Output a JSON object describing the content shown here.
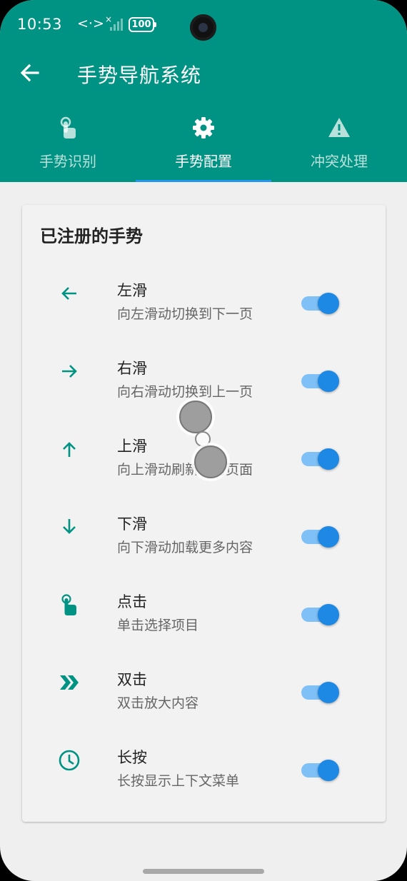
{
  "status_bar": {
    "time": "10:53",
    "network_symbol": "<·>",
    "network_flag": "×",
    "battery": "100"
  },
  "app_bar": {
    "title": "手势导航系统",
    "back_icon": "arrow-back-icon",
    "background_color": "#009282"
  },
  "tabs": [
    {
      "label": "手势识别",
      "icon": "touch-icon",
      "active": false
    },
    {
      "label": "手势配置",
      "icon": "gear-icon",
      "active": true
    },
    {
      "label": "冲突处理",
      "icon": "warning-icon",
      "active": false
    }
  ],
  "card": {
    "title": "已注册的手势",
    "gestures": [
      {
        "name": "左滑",
        "description": "向左滑动切换到下一页",
        "icon": "arrow-left-icon",
        "enabled": true
      },
      {
        "name": "右滑",
        "description": "向右滑动切换到上一页",
        "icon": "arrow-right-icon",
        "enabled": true
      },
      {
        "name": "上滑",
        "description": "向上滑动刷新当前页面",
        "icon": "arrow-up-icon",
        "enabled": true
      },
      {
        "name": "下滑",
        "description": "向下滑动加载更多内容",
        "icon": "arrow-down-icon",
        "enabled": true
      },
      {
        "name": "点击",
        "description": "单击选择项目",
        "icon": "touch-icon",
        "enabled": true
      },
      {
        "name": "双击",
        "description": "双击放大内容",
        "icon": "double-chevron-icon",
        "enabled": true
      },
      {
        "name": "长按",
        "description": "长按显示上下文菜单",
        "icon": "clock-icon",
        "enabled": true
      }
    ]
  },
  "colors": {
    "accent": "#009282",
    "switch_thumb": "#1e88e5",
    "switch_track": "#7fc1f6",
    "tab_indicator": "#2196f3"
  }
}
